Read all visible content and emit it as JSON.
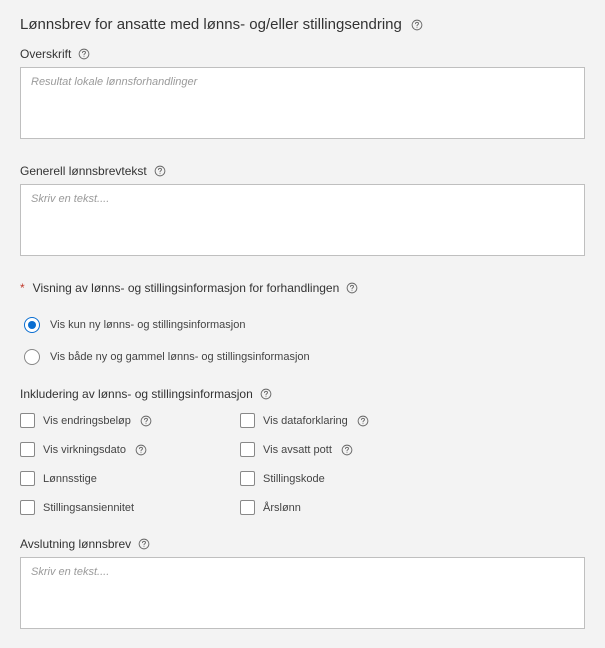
{
  "page": {
    "title": "Lønnsbrev for ansatte med lønns- og/eller stillingsendring"
  },
  "overskrift": {
    "label": "Overskrift",
    "placeholder": "Resultat lokale lønnsforhandlinger"
  },
  "generell": {
    "label": "Generell lønnsbrevtekst",
    "placeholder": "Skriv en tekst...."
  },
  "visning": {
    "label": "Visning av lønns- og stillingsinformasjon for forhandlingen",
    "options": [
      "Vis kun ny lønns- og stillingsinformasjon",
      "Vis både ny og gammel lønns- og stillingsinformasjon"
    ]
  },
  "inkludering": {
    "label": "Inkludering av lønns- og stillingsinformasjon",
    "left": [
      {
        "label": "Vis endringsbeløp",
        "help": true
      },
      {
        "label": "Vis virkningsdato",
        "help": true
      },
      {
        "label": "Lønnsstige",
        "help": false
      },
      {
        "label": "Stillingsansiennitet",
        "help": false
      }
    ],
    "right": [
      {
        "label": "Vis dataforklaring",
        "help": true
      },
      {
        "label": "Vis avsatt pott",
        "help": true
      },
      {
        "label": "Stillingskode",
        "help": false
      },
      {
        "label": "Årslønn",
        "help": false
      }
    ]
  },
  "avslutning": {
    "label": "Avslutning lønnsbrev",
    "placeholder": "Skriv en tekst...."
  }
}
